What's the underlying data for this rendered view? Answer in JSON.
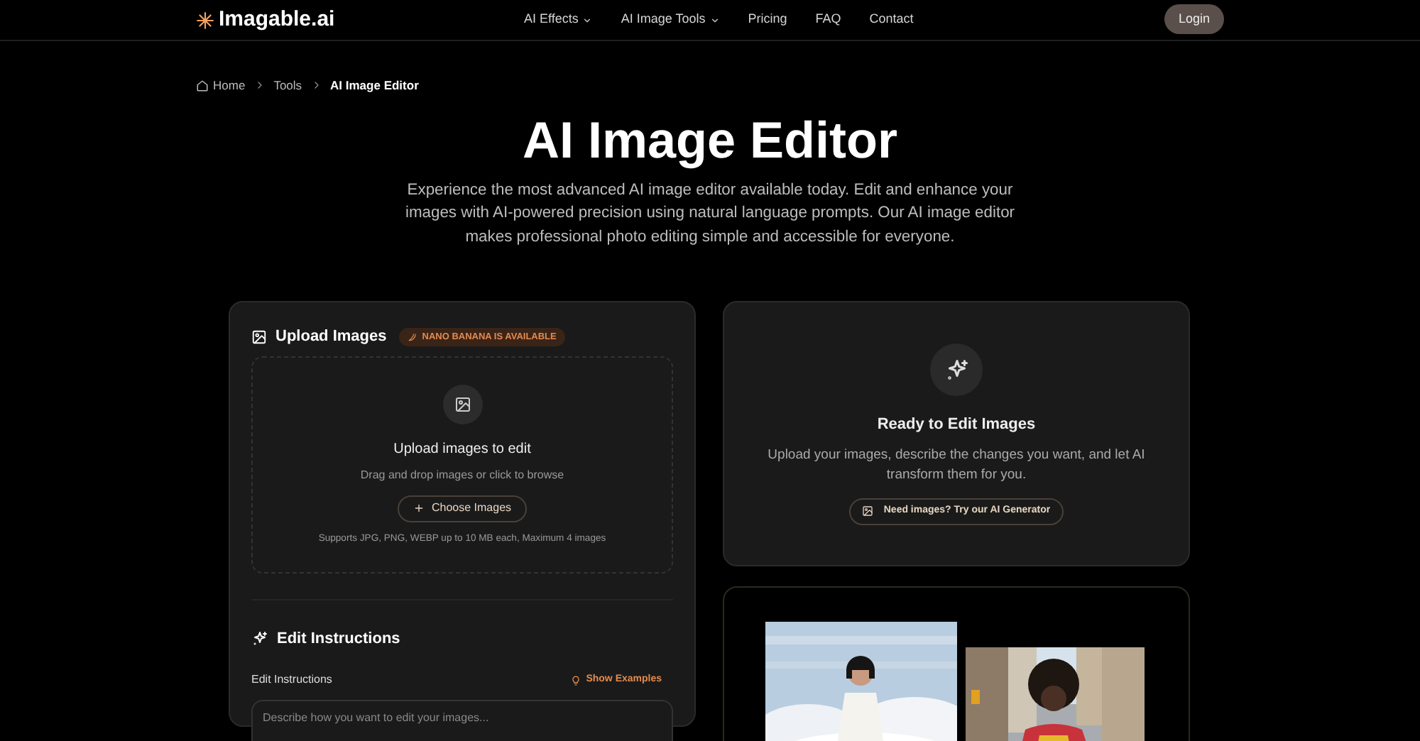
{
  "nav": {
    "logo": "Imagable.ai",
    "links": [
      {
        "label": "AI Effects",
        "dropdown": true
      },
      {
        "label": "AI Image Tools",
        "dropdown": true
      },
      {
        "label": "Pricing",
        "dropdown": false
      },
      {
        "label": "FAQ",
        "dropdown": false
      },
      {
        "label": "Contact",
        "dropdown": false
      }
    ],
    "login": "Login"
  },
  "breadcrumb": [
    "Home",
    "Tools",
    "AI Image Editor"
  ],
  "hero": {
    "title": "AI Image Editor",
    "description": "Experience the most advanced AI image editor available today. Edit and enhance your images with AI-powered precision using natural language prompts. Our AI image editor makes professional photo editing simple and accessible for everyone."
  },
  "upload": {
    "title": "Upload Images",
    "badge": "NANO BANANA IS AVAILABLE",
    "heading": "Upload images to edit",
    "hint": "Drag and drop images or click to browse",
    "button": "Choose Images",
    "note": "Supports JPG, PNG, WEBP up to 10 MB each, Maximum 4 images"
  },
  "instructions": {
    "title": "Edit Instructions",
    "label": "Edit Instructions",
    "examples": "Show Examples",
    "placeholder": "Describe how you want to edit your images..."
  },
  "ready": {
    "title": "Ready to Edit Images",
    "text": "Upload your images, describe the changes you want, and let AI transform them for you.",
    "button": "Need images? Try our AI Generator"
  }
}
